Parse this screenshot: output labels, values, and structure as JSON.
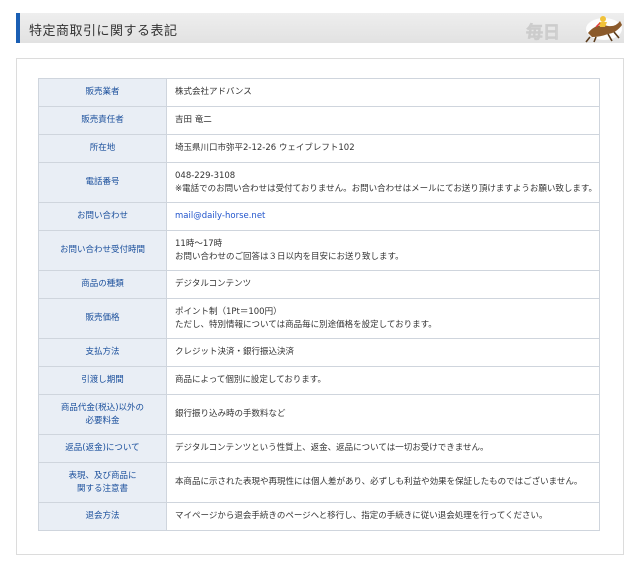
{
  "header": {
    "title": "特定商取引に関する表記",
    "logo_text": "毎日"
  },
  "rows": [
    {
      "label": [
        "販売業者"
      ],
      "lines": [
        "株式会社アドバンス"
      ]
    },
    {
      "label": [
        "販売責任者"
      ],
      "lines": [
        "吉田 竜二"
      ]
    },
    {
      "label": [
        "所在地"
      ],
      "lines": [
        "埼玉県川口市弥平2-12-26 ウェイブレフト102"
      ]
    },
    {
      "label": [
        "電話番号"
      ],
      "lines": [
        "048-229-3108",
        "※電話でのお問い合わせは受付ておりません。お問い合わせはメールにてお送り頂けますようお願い致します。"
      ]
    },
    {
      "label": [
        "お問い合わせ"
      ],
      "lines": [
        "mail@daily-horse.net"
      ],
      "link": true
    },
    {
      "label": [
        "お問い合わせ受付時間"
      ],
      "lines": [
        "11時～17時",
        "お問い合わせのご回答は３日以内を目安にお送り致します。"
      ]
    },
    {
      "label": [
        "商品の種類"
      ],
      "lines": [
        "デジタルコンテンツ"
      ]
    },
    {
      "label": [
        "販売価格"
      ],
      "lines": [
        "ポイント制（1Pt＝100円）",
        "ただし、特別情報については商品毎に別途価格を設定しております。"
      ]
    },
    {
      "label": [
        "支払方法"
      ],
      "lines": [
        "クレジット決済・銀行振込決済"
      ]
    },
    {
      "label": [
        "引渡し期間"
      ],
      "lines": [
        "商品によって個別に設定しております。"
      ]
    },
    {
      "label": [
        "商品代金(税込)以外の",
        "必要料金"
      ],
      "lines": [
        "銀行振り込み時の手数料など"
      ]
    },
    {
      "label": [
        "返品(返金)について"
      ],
      "lines": [
        "デジタルコンテンツという性質上、返金、返品については一切お受けできません。"
      ]
    },
    {
      "label": [
        "表現、及び商品に",
        "関する注意書"
      ],
      "lines": [
        "本商品に示された表現や再現性には個人差があり、必ずしも利益や効果を保証したものではございません。"
      ]
    },
    {
      "label": [
        "退会方法"
      ],
      "lines": [
        "マイページから退会手続きのページへと移行し、指定の手続きに従い退会処理を行ってください。"
      ]
    }
  ]
}
